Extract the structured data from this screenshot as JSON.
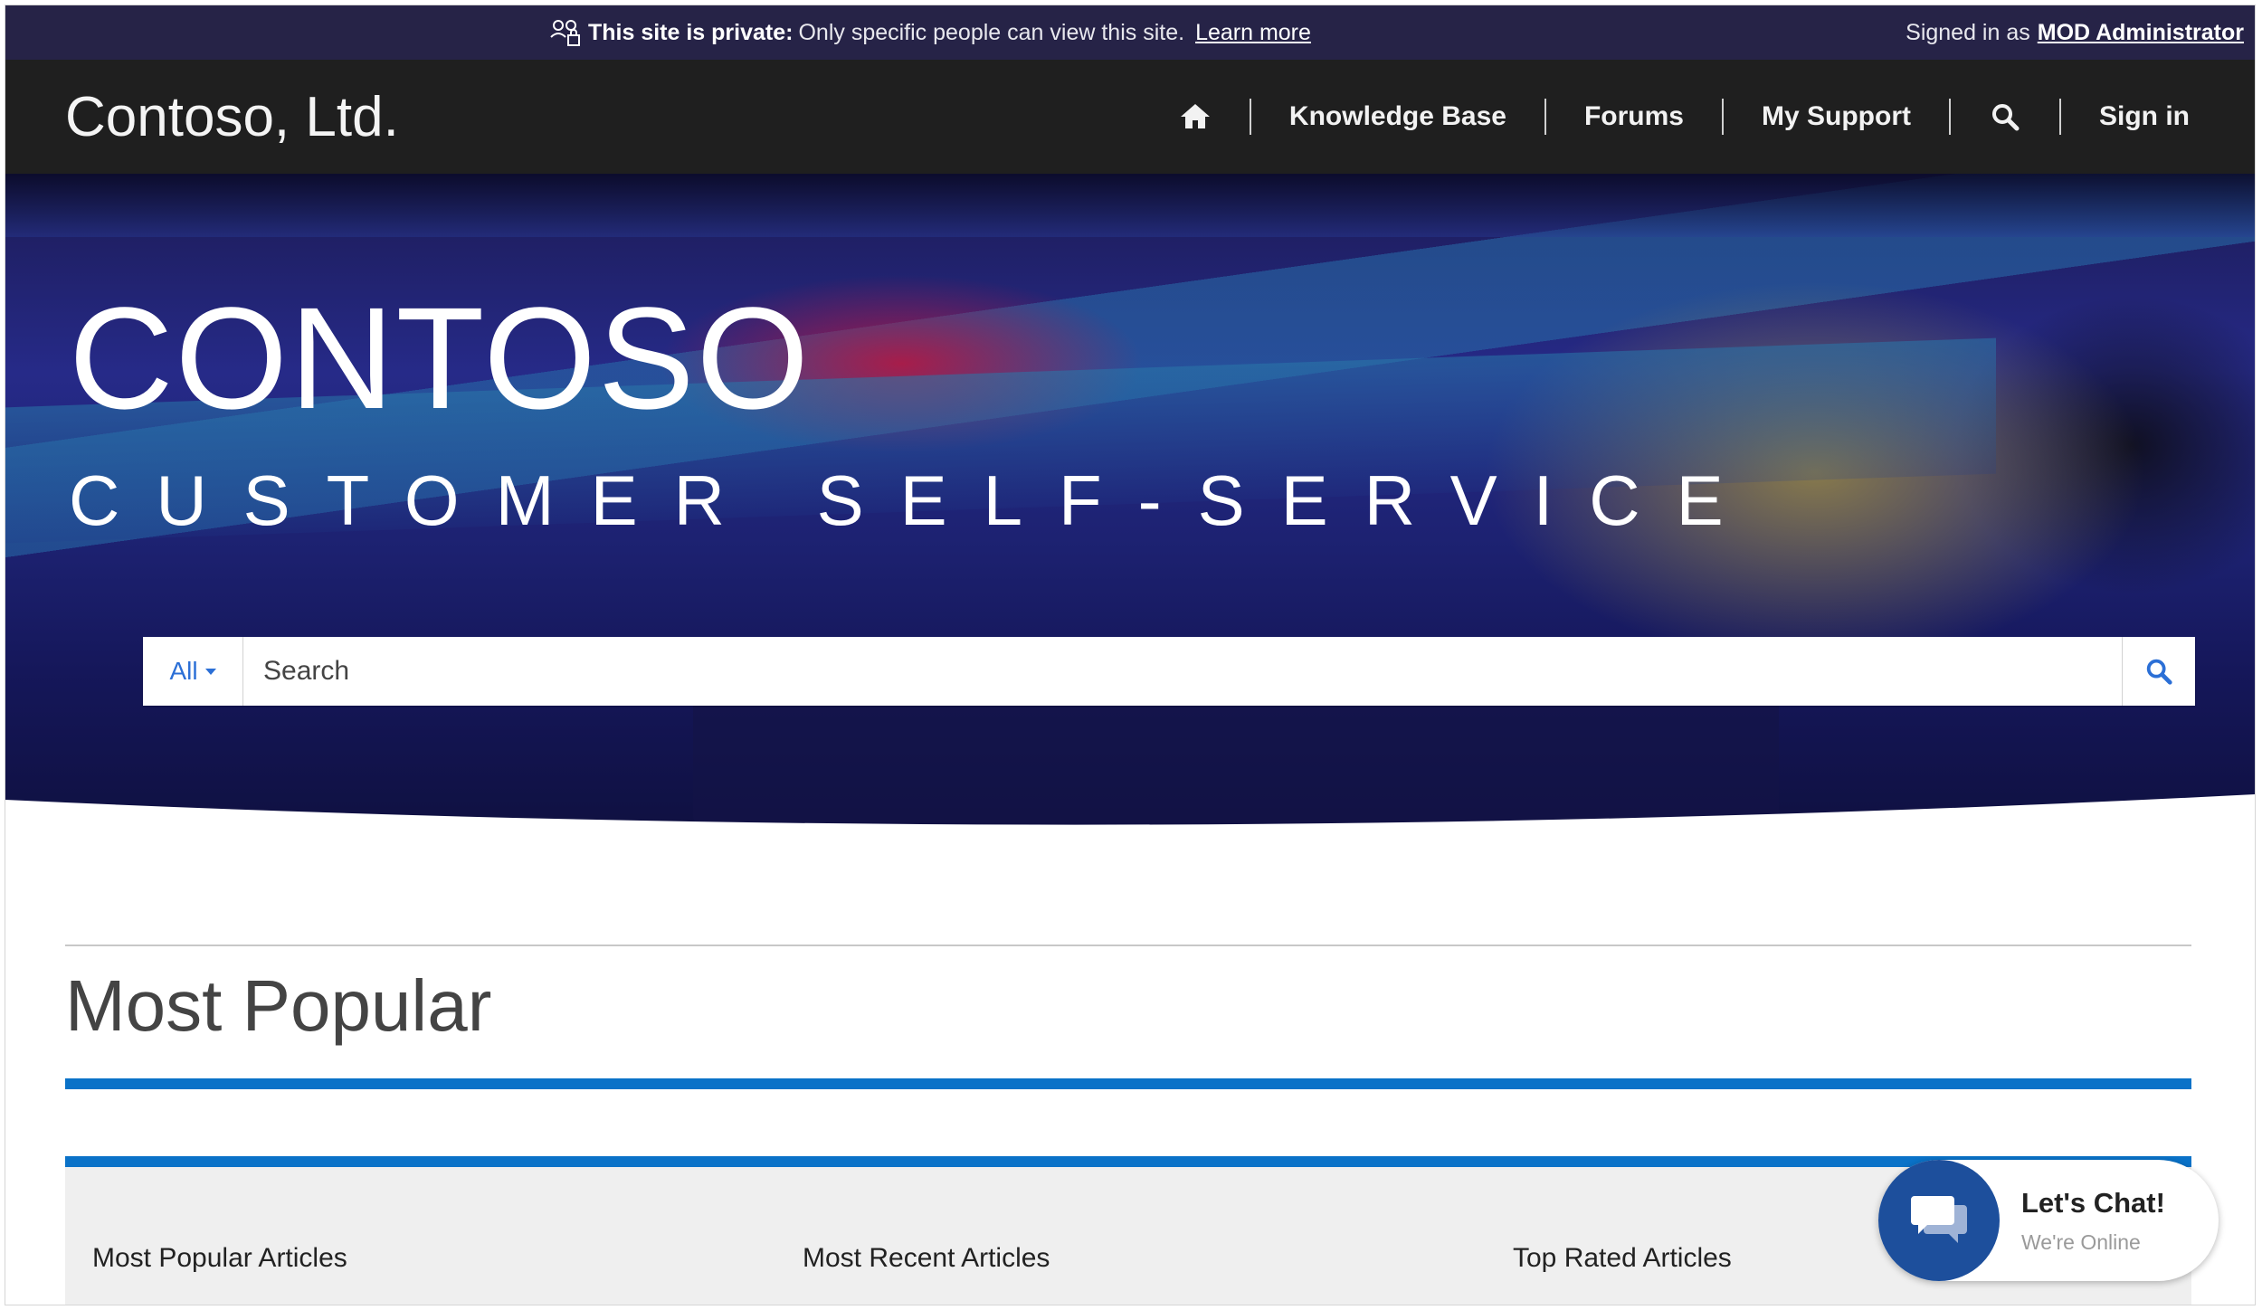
{
  "banner": {
    "private_bold": "This site is private:",
    "private_text": "Only specific people can view this site.",
    "learn_more": "Learn more",
    "signed_in_prefix": "Signed in as",
    "user_name": "MOD Administrator"
  },
  "header": {
    "brand": "Contoso, Ltd.",
    "nav": {
      "home_icon": "home-icon",
      "knowledge_base": "Knowledge Base",
      "forums": "Forums",
      "my_support": "My Support",
      "search_icon": "search-icon",
      "sign_in": "Sign in"
    }
  },
  "hero": {
    "title": "CONTOSO",
    "subtitle": "CUSTOMER SELF-SERVICE"
  },
  "search": {
    "filter_label": "All",
    "placeholder": "Search",
    "button_icon": "search-icon"
  },
  "main": {
    "section_title": "Most Popular",
    "tabs": [
      {
        "label": "Most Popular Articles"
      },
      {
        "label": "Most Recent Articles"
      },
      {
        "label": "Top Rated Articles"
      }
    ]
  },
  "chat": {
    "title": "Let's Chat!",
    "subtitle": "We're Online",
    "icon": "chat-bubbles-icon"
  },
  "colors": {
    "banner_bg": "#262347",
    "header_bg": "#1f1f1f",
    "accent_blue": "#0a72c8",
    "chat_blue": "#1d4f9c",
    "link_blue": "#2b6fd6"
  }
}
